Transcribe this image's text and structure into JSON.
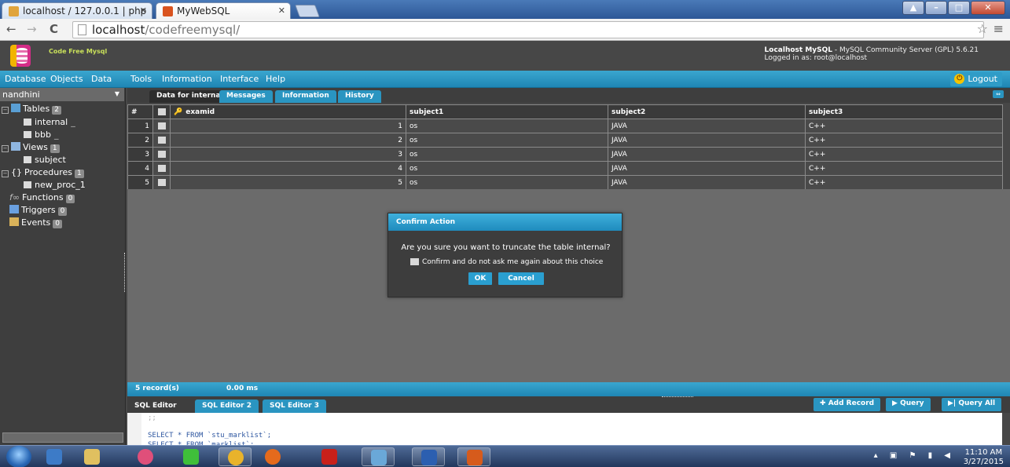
{
  "browser": {
    "tabs": [
      {
        "title": "localhost / 127.0.0.1 | php"
      },
      {
        "title": "MyWebSQL"
      }
    ],
    "url_host": "localhost",
    "url_path": "/codefreemysql/"
  },
  "header": {
    "logo_text": "Code Free Mysql",
    "server_name": "Localhost MySQL",
    "server_version": " - MySQL Community Server (GPL) 5.6.21",
    "logged_in": "Logged in as: root@localhost"
  },
  "menu": {
    "items": [
      "Database",
      "Objects",
      "Data",
      "Tools",
      "Information",
      "Interface",
      "Help"
    ],
    "logout": "Logout"
  },
  "sidebar": {
    "database": "nandhini",
    "tables_label": "Tables",
    "tables_count": "2",
    "tables": [
      "internal",
      "bbb"
    ],
    "views_label": "Views",
    "views_count": "1",
    "views": [
      "subject"
    ],
    "procedures_label": "Procedures",
    "procedures_count": "1",
    "procedures": [
      "new_proc_1"
    ],
    "functions_label": "Functions",
    "functions_count": "0",
    "triggers_label": "Triggers",
    "triggers_count": "0",
    "events_label": "Events",
    "events_count": "0"
  },
  "main_tabs": [
    "Data for internal",
    "Messages",
    "Information",
    "History"
  ],
  "grid": {
    "columns": [
      "#",
      "examid",
      "subject1",
      "subject2",
      "subject3"
    ],
    "rows": [
      [
        "1",
        "1",
        "os",
        "JAVA",
        "C++"
      ],
      [
        "2",
        "2",
        "os",
        "JAVA",
        "C++"
      ],
      [
        "3",
        "3",
        "os",
        "JAVA",
        "C++"
      ],
      [
        "4",
        "4",
        "os",
        "JAVA",
        "C++"
      ],
      [
        "5",
        "5",
        "os",
        "JAVA",
        "C++"
      ]
    ]
  },
  "dialog": {
    "title": "Confirm Action",
    "question": "Are you sure you want to truncate the table internal?",
    "checkbox_label": "Confirm and do not ask me again about this choice",
    "ok": "OK",
    "cancel": "Cancel"
  },
  "status": {
    "records": "5 record(s)",
    "time": "0.00 ms"
  },
  "editor": {
    "tabs": [
      "SQL Editor",
      "SQL Editor 2",
      "SQL Editor 3"
    ],
    "buttons": [
      "Add Record",
      "Query",
      "Query All"
    ],
    "lines": [
      ";;",
      "SELECT * FROM `stu_marklist`;",
      "SELECT * FROM `marklist`;"
    ]
  },
  "taskbar": {
    "time": "11:10 AM",
    "date": "3/27/2015"
  }
}
